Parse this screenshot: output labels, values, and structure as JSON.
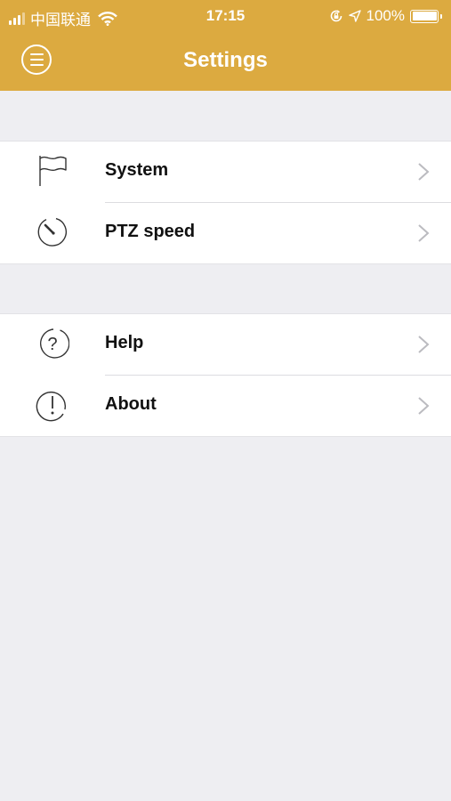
{
  "status_bar": {
    "carrier": "中国联通",
    "time": "17:15",
    "battery": "100%"
  },
  "header": {
    "title": "Settings",
    "menu_icon": "menu-circle-icon",
    "color": "#dcaa40"
  },
  "groups": [
    {
      "items": [
        {
          "label": "System",
          "icon": "flag-icon"
        },
        {
          "label": "PTZ speed",
          "icon": "timer-icon"
        }
      ]
    },
    {
      "items": [
        {
          "label": "Help",
          "icon": "question-icon"
        },
        {
          "label": "About",
          "icon": "info-exclamation-icon"
        }
      ]
    }
  ]
}
